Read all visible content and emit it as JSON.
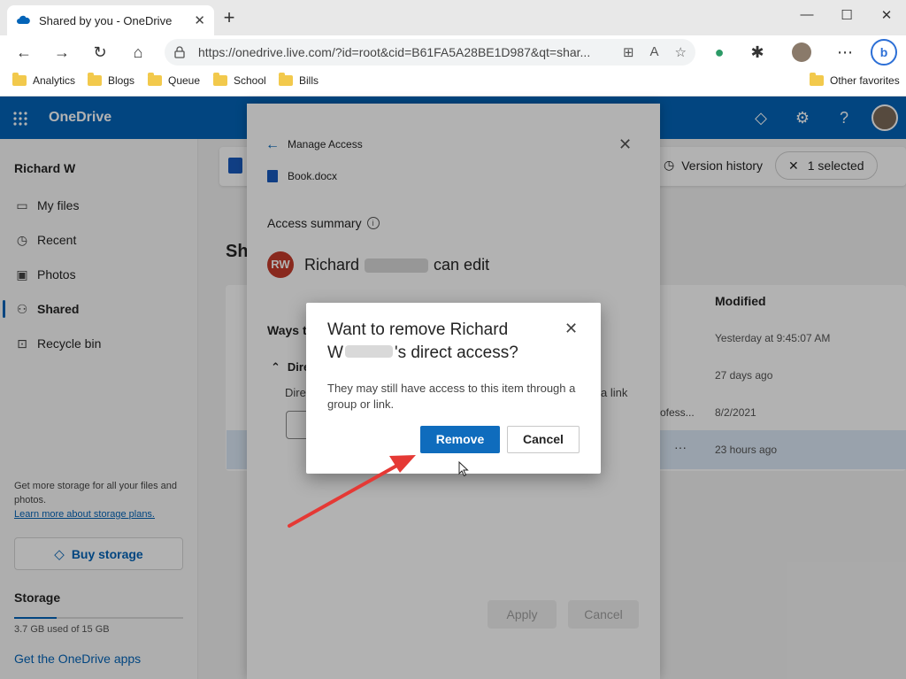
{
  "browser": {
    "tab_title": "Shared by you - OneDrive",
    "new_tab": "+",
    "url": "https://onedrive.live.com/?id=root&cid=B61FA5A28BE1D987&qt=shar...",
    "bookmarks": [
      "Analytics",
      "Blogs",
      "Queue",
      "School",
      "Bills"
    ],
    "other_favorites": "Other favorites"
  },
  "app": {
    "brand": "OneDrive"
  },
  "sidebar": {
    "user": "Richard W",
    "items": [
      {
        "label": "My files",
        "icon": "folder-icon"
      },
      {
        "label": "Recent",
        "icon": "clock-icon"
      },
      {
        "label": "Photos",
        "icon": "photo-icon"
      },
      {
        "label": "Shared",
        "icon": "people-icon",
        "active": true
      },
      {
        "label": "Recycle bin",
        "icon": "trash-icon"
      }
    ],
    "promo": "Get more storage for all your files and photos.",
    "promo_link": "Learn more about storage plans.",
    "buy_storage": "Buy storage",
    "storage_title": "Storage",
    "storage_used": "3.7 GB used of 15 GB",
    "storage_fraction": 0.25,
    "get_apps": "Get the OneDrive apps"
  },
  "main": {
    "version_history": "Version history",
    "selected": "1 selected",
    "heading_partial": "Sh",
    "modified_header": "Modified",
    "modified": [
      "Yesterday at 9:45:07 AM",
      "27 days ago",
      "8/2/2021",
      "23 hours ago"
    ],
    "row_partial": "ofess...",
    "more": "···"
  },
  "panel": {
    "title": "Manage Access",
    "document": "Book.docx",
    "access_summary": "Access summary",
    "avatar_initials": "RW",
    "person_first": "Richard",
    "person_suffix": "can edit",
    "ways_partial": "Ways th",
    "direct_partial": "Dire",
    "direct_partial2": "Dire",
    "a_link_partial": "a link",
    "apply": "Apply",
    "cancel": "Cancel"
  },
  "dialog": {
    "title_line1": "Want to remove Richard",
    "title_line2_prefix": "W",
    "title_line2_suffix": "'s direct access?",
    "body": "They may still have access to this item through a group or link.",
    "remove": "Remove",
    "cancel": "Cancel"
  },
  "colors": {
    "brand": "#0364b8",
    "primary_button": "#0f6cbd",
    "annotation_arrow": "#e53935",
    "avatar": "#c43c2c"
  }
}
